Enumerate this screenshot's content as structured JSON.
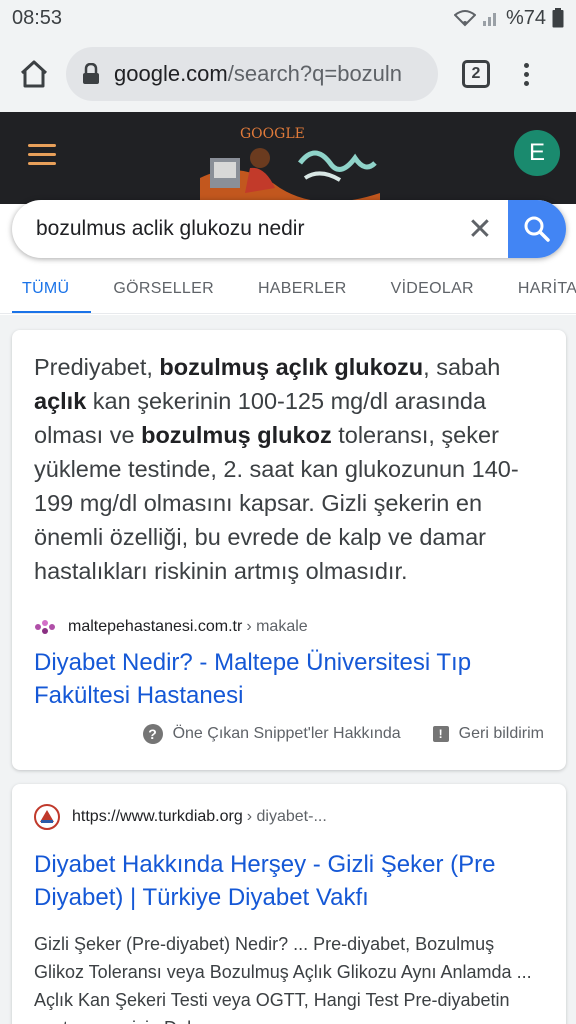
{
  "status_bar": {
    "time": "08:53",
    "battery": "%74"
  },
  "browser": {
    "url_domain": "google.com",
    "url_rest": "/search?q=bozuln",
    "tab_count": "2"
  },
  "google_header": {
    "avatar_letter": "E",
    "doodle_text": "GOOGLE"
  },
  "search": {
    "query": "bozulmus aclik glukozu nedir",
    "clear_symbol": "✕"
  },
  "tabs": [
    {
      "label": "TÜMÜ",
      "active": true
    },
    {
      "label": "GÖRSELLER",
      "active": false
    },
    {
      "label": "HABERLER",
      "active": false
    },
    {
      "label": "VİDEOLAR",
      "active": false
    },
    {
      "label": "HARİTA",
      "active": false
    }
  ],
  "featured_snippet": {
    "text_parts": [
      {
        "t": "Prediyabet, ",
        "b": false
      },
      {
        "t": "bozulmuş açlık glukozu",
        "b": true
      },
      {
        "t": ", sabah ",
        "b": false
      },
      {
        "t": "açlık",
        "b": true
      },
      {
        "t": " kan şekerinin 100-125 mg/dl arasında olması ve ",
        "b": false
      },
      {
        "t": "bozulmuş glukoz",
        "b": true
      },
      {
        "t": " toleransı, şeker yükleme testinde, 2. saat kan glukozunun 140-199 mg/dl olmasını kapsar. Gizli şekerin en önemli özelliği, bu evrede de kalp ve damar hastalıkları riskinin artmış olmasıdır.",
        "b": false
      }
    ],
    "source_domain": "maltepehastanesi.com.tr",
    "source_crumb": "› makale",
    "title": "Diyabet Nedir? - Maltepe Üniversitesi Tıp Fakültesi Hastanesi",
    "about_label": "Öne Çıkan Snippet'ler Hakkında",
    "feedback_label": "Geri bildirim"
  },
  "result2": {
    "source_url": "https://www.turkdiab.org",
    "source_crumb": "› diyabet-...",
    "title": "Diyabet Hakkında Herşey - Gizli Şeker (Pre Diyabet) | Türkiye Diyabet Vakfı",
    "description": "Gizli Şeker (Pre-diyabet) Nedir? ... Pre-diyabet, Bozulmuş Glikoz Toleransı veya Bozulmuş Açlık Glikozu Aynı Anlamda ... Açlık Kan Şekeri Testi veya OGTT, Hangi Test Pre-diyabetin saptanması için Daha ..."
  },
  "colors": {
    "accent": "#1a73e8",
    "link": "#1558d6",
    "header_bg": "#202124",
    "avatar_bg": "#1a8a6e",
    "search_button": "#4285f4"
  }
}
